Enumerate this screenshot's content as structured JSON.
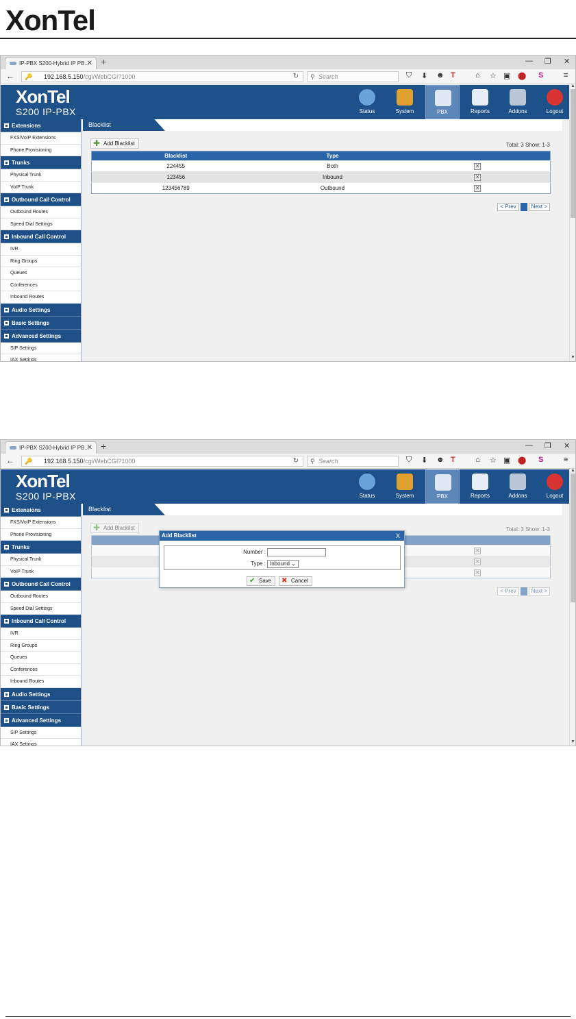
{
  "doc": {
    "logo": "XonTel"
  },
  "browser": {
    "tab_title": "IP-PBX S200-Hybrid IP PB...",
    "url_host": "192.168.5.150",
    "url_path": "/cgi/WebCGI?1000",
    "search_placeholder": "Search"
  },
  "app": {
    "logo": "XonTel",
    "model": "S200 IP-PBX",
    "nav": [
      {
        "label": "Status",
        "color": "#6aa3d8"
      },
      {
        "label": "System",
        "color": "#e0a030"
      },
      {
        "label": "PBX",
        "color": "#dfe9f4"
      },
      {
        "label": "Reports",
        "color": "#e8eef6"
      },
      {
        "label": "Addons",
        "color": "#b9c7d8"
      },
      {
        "label": "Logout",
        "color": "#d93434"
      }
    ]
  },
  "sidebar": {
    "sections": [
      {
        "title": "Extensions",
        "items": [
          "FXS/VoIP Extensions",
          "Phone Provisioning"
        ]
      },
      {
        "title": "Trunks",
        "items": [
          "Physical Trunk",
          "VoIP Trunk"
        ]
      },
      {
        "title": "Outbound Call Control",
        "items": [
          "Outbound Routes",
          "Speed Dial Settings"
        ]
      },
      {
        "title": "Inbound Call Control",
        "items": [
          "IVR",
          "Ring Groups",
          "Queues",
          "Conferences",
          "Inbound Routes"
        ]
      },
      {
        "title": "Audio Settings",
        "items": []
      },
      {
        "title": "Basic Settings",
        "items": []
      },
      {
        "title": "Advanced Settings",
        "items": [
          "SIP Settings",
          "IAX Settings"
        ]
      }
    ]
  },
  "content": {
    "breadcrumb": "Blacklist",
    "add_button": "Add Blacklist",
    "totals": "Total: 3   Show: 1-3",
    "table": {
      "headers": [
        "Blacklist",
        "Type"
      ],
      "rows": [
        {
          "number": "224455",
          "type": "Both"
        },
        {
          "number": "123456",
          "type": "Inbound"
        },
        {
          "number": "123456789",
          "type": "Outbound"
        }
      ]
    },
    "pager": {
      "prev": "< Prev",
      "current": "1",
      "next": "Next >"
    }
  },
  "dialog": {
    "title": "Add Blacklist",
    "close": "X",
    "number_label": "Number :",
    "type_label": "Type :",
    "type_value": "Inbound",
    "save": "Save",
    "cancel": "Cancel"
  }
}
